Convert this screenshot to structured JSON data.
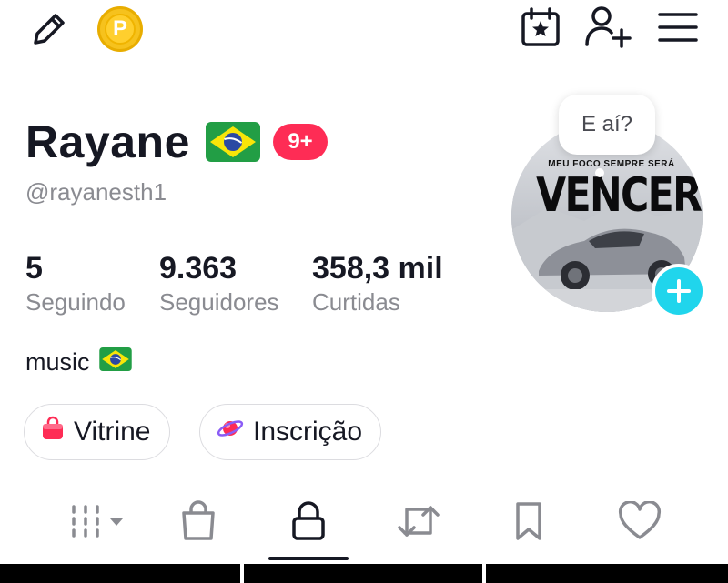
{
  "top_bar": {
    "edit_icon": "pencil-icon",
    "coin_letter": "P",
    "calendar_icon": "calendar-star-icon",
    "add_friend_icon": "add-user-icon",
    "menu_icon": "hamburger-menu-icon"
  },
  "profile": {
    "name": "Rayane",
    "name_flag": "brazil-flag-icon",
    "notification_badge": "9+",
    "handle": "@rayanesth1",
    "bubble_text": "E aí?",
    "avatar_text_top": "MEU FOCO SEMPRE SERÁ",
    "avatar_text_main": "VENCER"
  },
  "stats": [
    {
      "value": "5",
      "label": "Seguindo"
    },
    {
      "value": "9.363",
      "label": "Seguidores"
    },
    {
      "value": "358,3 mil",
      "label": "Curtidas"
    }
  ],
  "bio": {
    "text": "music",
    "flag": "brazil-flag-icon"
  },
  "buttons": {
    "showcase_label": "Vitrine",
    "subscription_label": "Inscrição"
  },
  "tabs": [
    {
      "name": "videos-grid-icon"
    },
    {
      "name": "shopping-bag-icon"
    },
    {
      "name": "lock-icon",
      "active": true
    },
    {
      "name": "repost-icon"
    },
    {
      "name": "bookmark-icon"
    },
    {
      "name": "heart-icon"
    }
  ],
  "colors": {
    "accent_red": "#fe2c55",
    "accent_cyan": "#20d5ec",
    "coin_yellow": "#f6c21d",
    "text_primary": "#161823",
    "text_secondary": "#8a8b91"
  }
}
